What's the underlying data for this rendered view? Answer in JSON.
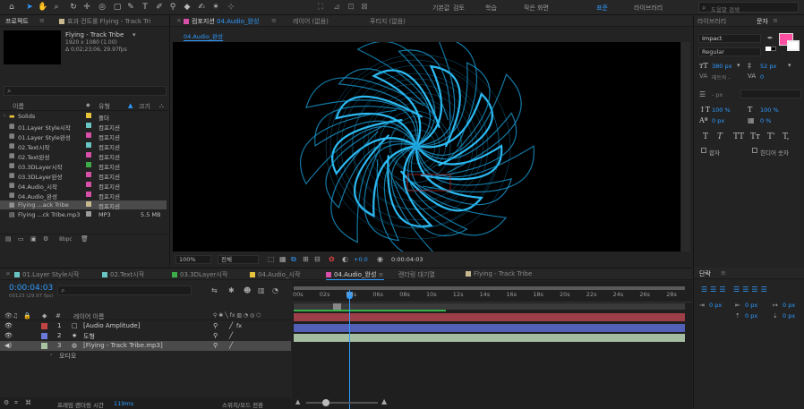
{
  "workspaces": [
    "기본값",
    "검토",
    "학습",
    "작은 화면",
    "표준",
    "라이브러리"
  ],
  "search": {
    "placeholder": "도움말 검색"
  },
  "project": {
    "tab_label": "프로젝트",
    "effects_tab": "효과 컨트롤 Flying - Track Tri",
    "item_name": "Flying - Track Tribe",
    "item_meta1": "1920 x 1080 (1.00)",
    "item_meta2": "Δ 0;02;23;06, 29.97fps",
    "col_name": "이름",
    "col_type": "유형",
    "col_size": "크기",
    "bpc": "8bpc",
    "items": [
      {
        "name": "Solids",
        "type": "폴더",
        "color": "#e8c23c",
        "size": "",
        "folder": true
      },
      {
        "name": "01.Layer Style시작",
        "type": "컴포지션",
        "color": "#6bc4c4",
        "size": ""
      },
      {
        "name": "01.Layer Style완성",
        "type": "컴포지션",
        "color": "#d84fa8",
        "size": ""
      },
      {
        "name": "02.Text시작",
        "type": "컴포지션",
        "color": "#6bc4c4",
        "size": ""
      },
      {
        "name": "02.Text완성",
        "type": "컴포지션",
        "color": "#d84fa8",
        "size": ""
      },
      {
        "name": "03.3DLayer시작",
        "type": "컴포지션",
        "color": "#3cab48",
        "size": ""
      },
      {
        "name": "03.3DLayer완성",
        "type": "컴포지션",
        "color": "#d84fa8",
        "size": ""
      },
      {
        "name": "04.Audio_시작",
        "type": "컴포지션",
        "color": "#d84fa8",
        "size": ""
      },
      {
        "name": "04.Audio_완성",
        "type": "컴포지션",
        "color": "#d84fa8",
        "size": ""
      },
      {
        "name": "Flying ...ack Tribe",
        "type": "컴포지션",
        "color": "#c8b890",
        "size": "",
        "selected": true
      },
      {
        "name": "Flying ...ck Tribe.mp3",
        "type": "MP3",
        "color": "#9a9a9a",
        "size": "5.5 MB"
      }
    ]
  },
  "viewer": {
    "comp_tab": "컴포지션",
    "comp_tab_name": "04.Audio_완성",
    "layer_tab": "레이어 (없음)",
    "footage_tab": "푸티지 (없음)",
    "breadcrumb": "04.Audio_완성",
    "zoom": "100%",
    "resolution": "전체",
    "exposure": "+0.0",
    "timecode": "0:00:04:03"
  },
  "timeline": {
    "tabs": [
      {
        "label": "01.Layer Style시작",
        "color": "#6bc4c4"
      },
      {
        "label": "02.Text시작",
        "color": "#6bc4c4"
      },
      {
        "label": "03.3DLayer시작",
        "color": "#3cab48"
      },
      {
        "label": "04.Audio_시작",
        "color": "#e8c23c"
      },
      {
        "label": "04.Audio_완성",
        "color": "#d84fa8",
        "active": true
      },
      {
        "label": "렌더링 대기열",
        "color": ""
      },
      {
        "label": "Flying - Track Tribe",
        "color": "#c8b890"
      }
    ],
    "current_time": "0:00:04:03",
    "fps_info": "00123 (29.97 fps)",
    "col_layer_name": "레이어 이름",
    "layers": [
      {
        "num": "1",
        "name": "[Audio Amplitude]",
        "color": "#c24545",
        "icon": "square",
        "fx": "fx"
      },
      {
        "num": "2",
        "name": "도형",
        "color": "#6a78d8",
        "icon": "star",
        "fx": ""
      },
      {
        "num": "3",
        "name": "[Flying - Track Tribe.mp3]",
        "color": "#a8c4a0",
        "icon": "audio",
        "fx": "",
        "selected": true
      }
    ],
    "audio_sub": "오디오",
    "ticks": [
      "00s",
      "02s",
      "04s",
      "06s",
      "08s",
      "10s",
      "12s",
      "14s",
      "16s",
      "18s",
      "20s",
      "22s",
      "24s",
      "26s",
      "28s"
    ],
    "frame_render_label": "프레임 렌더링 시간",
    "frame_render_value": "119ms",
    "switch_mode_label": "스위치/모드 전환"
  },
  "character": {
    "libraries_tab": "라이브러리",
    "character_tab": "문자",
    "font": "Impact",
    "style": "Regular",
    "size": "380 px",
    "leading": "52 px",
    "kerning": "메트릭 -",
    "tracking": "0",
    "stroke": "- px",
    "vscale": "100 %",
    "hscale": "100 %",
    "baseline": "0 px",
    "tsume": "0 %",
    "fill_color": "#ff4fa3",
    "buttons": [
      "T",
      "T",
      "TT",
      "Tт",
      "T'",
      "T,"
    ],
    "ligatures": "합자",
    "hindi_digits": "힌디어 숫자"
  },
  "paragraph": {
    "tab": "단락",
    "fields": [
      "0 px",
      "0 px",
      "0 px",
      "0 px",
      "0 px"
    ]
  }
}
